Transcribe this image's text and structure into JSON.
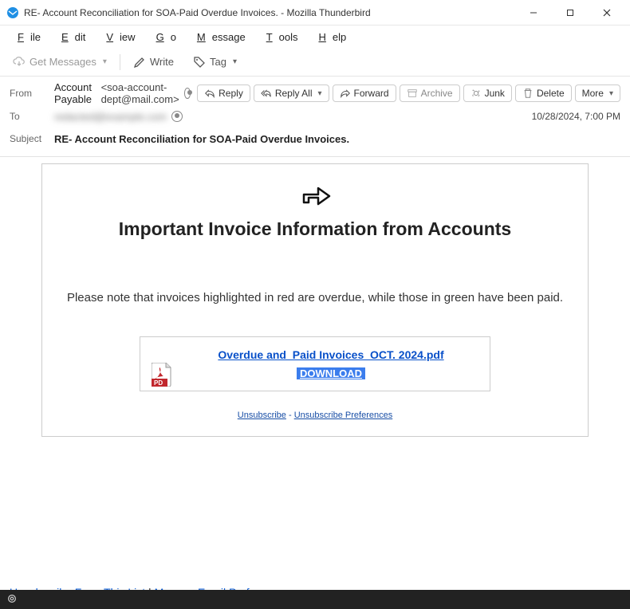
{
  "window": {
    "title": "RE- Account Reconciliation for SOA-Paid Overdue Invoices. - Mozilla Thunderbird"
  },
  "menu": {
    "file": "File",
    "edit": "Edit",
    "view": "View",
    "go": "Go",
    "message": "Message",
    "tools": "Tools",
    "help": "Help"
  },
  "toolbar": {
    "get_messages": "Get Messages",
    "write": "Write",
    "tag": "Tag"
  },
  "headers": {
    "from_label": "From",
    "to_label": "To",
    "subject_label": "Subject",
    "from_name": "Account Payable",
    "from_email": "<soa-account-dept@mail.com>",
    "to_value": "redacted@example.com",
    "subject": "RE- Account Reconciliation for SOA-Paid Overdue Invoices.",
    "date": "10/28/2024, 7:00 PM"
  },
  "actions": {
    "reply": "Reply",
    "reply_all": "Reply All",
    "forward": "Forward",
    "archive": "Archive",
    "junk": "Junk",
    "delete": "Delete",
    "more": "More"
  },
  "email": {
    "heading": "Important Invoice Information from Accounts",
    "paragraph": "Please note that invoices highlighted in red are overdue, while those in green have been paid.",
    "attachment_name": "Overdue and_Paid Invoices_OCT. 2024.pdf",
    "download_label": "DOWNLOAD",
    "unsubscribe": "Unsubscribe",
    "unsubscribe_sep": " - ",
    "unsub_prefs": "Unsubscribe Preferences",
    "footer_unsub": "Unsubscribe From This List",
    "footer_sep": " | ",
    "footer_manage": "Manage Email Preferences"
  }
}
